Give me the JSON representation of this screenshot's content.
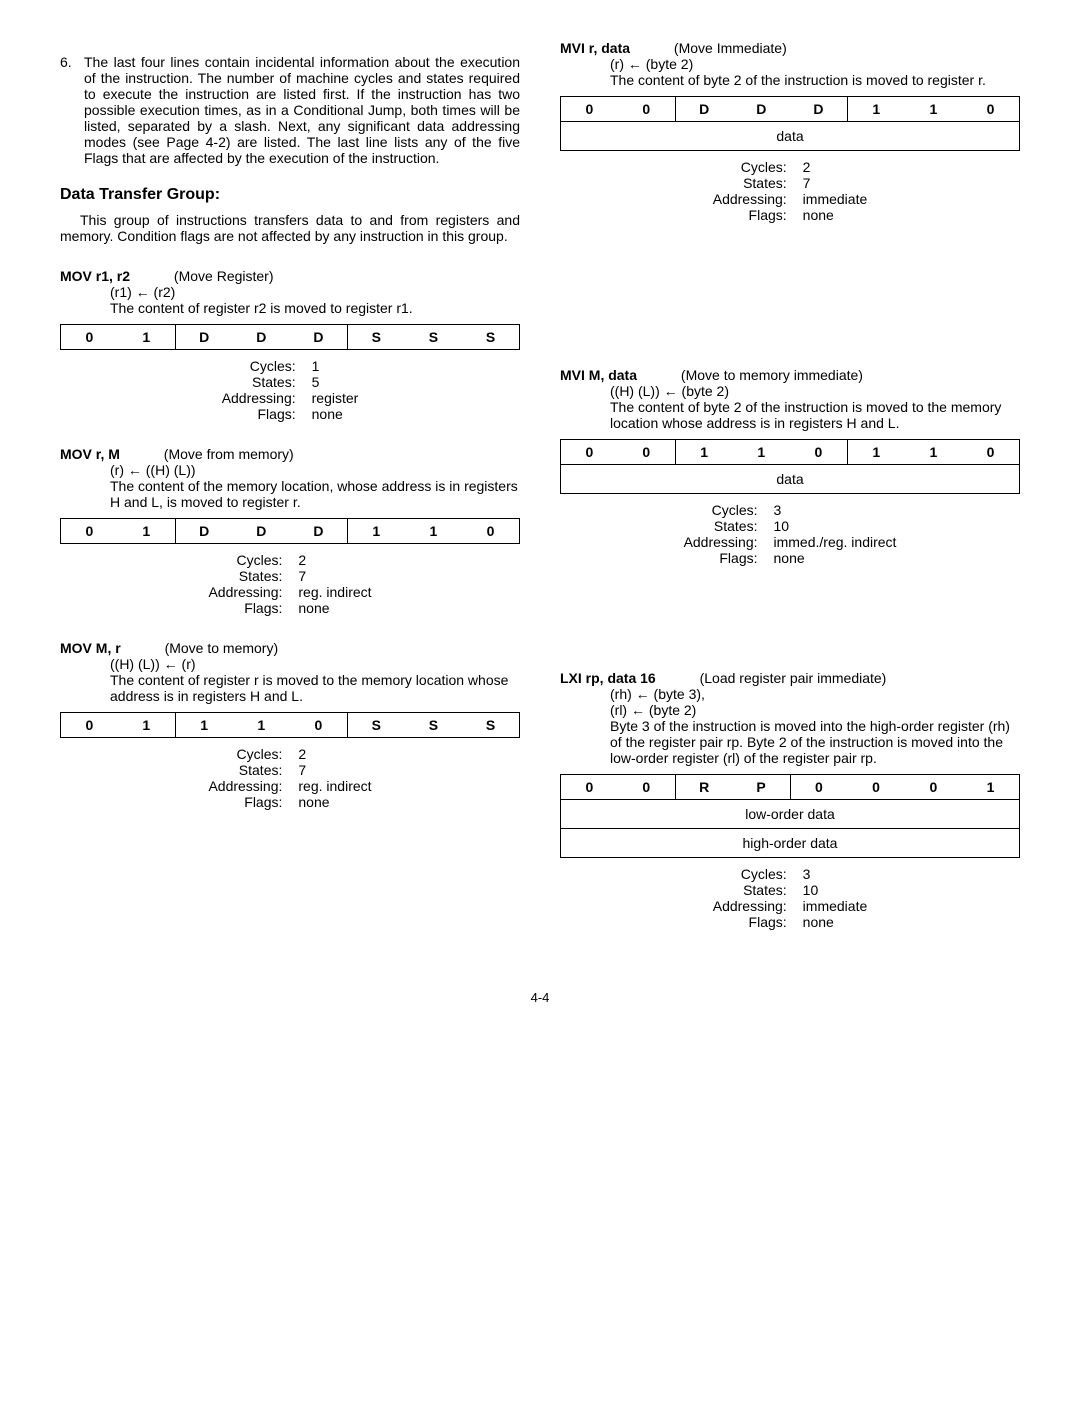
{
  "intro": {
    "num": "6.",
    "text": "The last four lines contain incidental information about the execution of the instruction. The number of machine cycles and states required to execute the instruction are listed first. If the instruction has two possible execution times, as in a Conditional Jump, both times will be listed, separated by a slash. Next, any significant data addressing modes (see Page 4-2) are listed. The last line lists any of the five Flags that are affected by the execution of the instruction."
  },
  "dtg": {
    "heading": "Data Transfer Group:",
    "text": "This group of instructions transfers data to and from registers and memory. Condition flags are not affected by any instruction in this group."
  },
  "labels": {
    "cycles": "Cycles:",
    "states": "States:",
    "addressing": "Addressing:",
    "flags": "Flags:",
    "data": "data",
    "low": "low-order data",
    "high": "high-order data",
    "pagenum": "4-4"
  },
  "mov_r1_r2": {
    "name": "MOV r1, r2",
    "desc": "(Move Register)",
    "op": "(r1) ← (r2)",
    "text": "The content of register r2 is moved to register r1.",
    "bits": [
      "0",
      "1",
      "D",
      "D",
      "D",
      "S",
      "S",
      "S"
    ],
    "cycles": "1",
    "states": "5",
    "addressing": "register",
    "flags": "none"
  },
  "mov_r_m": {
    "name": "MOV r, M",
    "desc": "(Move from memory)",
    "op": "(r) ← ((H) (L))",
    "text": "The content of the memory location, whose address is in registers H and L, is moved to register r.",
    "bits": [
      "0",
      "1",
      "D",
      "D",
      "D",
      "1",
      "1",
      "0"
    ],
    "cycles": "2",
    "states": "7",
    "addressing": "reg. indirect",
    "flags": "none"
  },
  "mov_m_r": {
    "name": "MOV M, r",
    "desc": "(Move to memory)",
    "op": "((H) (L)) ← (r)",
    "text": "The content of register r is moved to the memory location whose address is in registers H and L.",
    "bits": [
      "0",
      "1",
      "1",
      "1",
      "0",
      "S",
      "S",
      "S"
    ],
    "cycles": "2",
    "states": "7",
    "addressing": "reg. indirect",
    "flags": "none"
  },
  "mvi_r": {
    "name": "MVI r, data",
    "desc": "(Move Immediate)",
    "op": "(r) ← (byte 2)",
    "text": "The content of byte 2 of the instruction is moved to register r.",
    "bits": [
      "0",
      "0",
      "D",
      "D",
      "D",
      "1",
      "1",
      "0"
    ],
    "cycles": "2",
    "states": "7",
    "addressing": "immediate",
    "flags": "none"
  },
  "mvi_m": {
    "name": "MVI M, data",
    "desc": "(Move to memory immediate)",
    "op": "((H) (L)) ← (byte 2)",
    "text": "The content of byte 2 of the instruction is moved to the memory location whose address is in registers H and L.",
    "bits": [
      "0",
      "0",
      "1",
      "1",
      "0",
      "1",
      "1",
      "0"
    ],
    "cycles": "3",
    "states": "10",
    "addressing": "immed./reg. indirect",
    "flags": "none"
  },
  "lxi": {
    "name": "LXI rp, data 16",
    "desc": "(Load register pair immediate)",
    "op1": "(rh) ← (byte 3),",
    "op2": "(rl) ← (byte 2)",
    "text": "Byte 3 of the instruction is moved into the high-order register (rh) of the register pair rp. Byte 2 of the instruction is moved into the low-order register (rl) of the register pair rp.",
    "bits": [
      "0",
      "0",
      "R",
      "P",
      "0",
      "0",
      "0",
      "1"
    ],
    "cycles": "3",
    "states": "10",
    "addressing": "immediate",
    "flags": "none"
  }
}
